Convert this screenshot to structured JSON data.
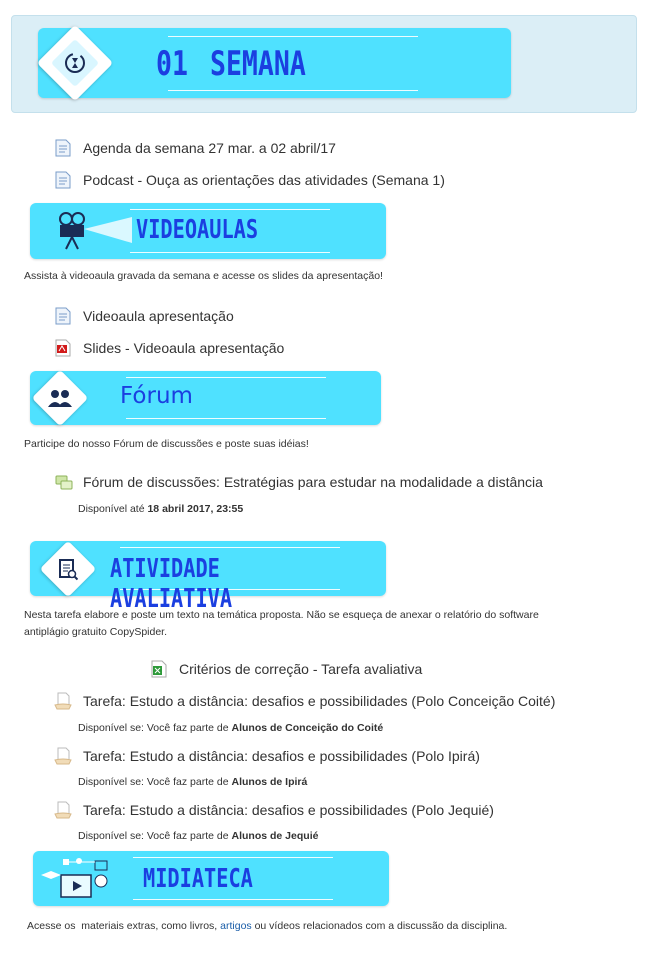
{
  "week_header": {
    "number": "01",
    "label": "SEMANA"
  },
  "resources_top": [
    {
      "label": "Agenda da semana 27 mar. a 02 abril/17",
      "icon": "page-icon"
    },
    {
      "label": "Podcast - Ouça as orientações das atividades (Semana 1)",
      "icon": "page-icon"
    }
  ],
  "videoaulas": {
    "title": "VIDEOAULAS",
    "description": "Assista à videoaula gravada da semana e acesse os slides da apresentação!",
    "items": [
      {
        "label": "Videoaula apresentação",
        "icon": "page-icon"
      },
      {
        "label": "Slides - Videoaula apresentação",
        "icon": "pdf-icon"
      }
    ]
  },
  "forum": {
    "title": "Fórum",
    "description": "Participe do nosso Fórum de discussões e poste suas idéias!",
    "item": {
      "label": "Fórum de discussões: Estratégias para estudar na modalidade a distância",
      "avail_prefix": "Disponível até ",
      "avail_value": "18 abril 2017, 23:55"
    }
  },
  "atividade": {
    "title": "ATIVIDADE AVALIATIVA",
    "description_line1": "Nesta tarefa elabore e poste um texto na temática proposta. Não se esqueça de anexar o relatório do software",
    "description_line2": "antiplágio gratuito CopySpider.",
    "criteria": {
      "label": "Critérios de correção - Tarefa avaliativa",
      "icon": "spreadsheet-icon"
    },
    "tasks": [
      {
        "label": "Tarefa: Estudo a distância: desafios e possibilidades (Polo Conceição Coité)",
        "avail_prefix": "Disponível se: Você faz parte de ",
        "avail_value": "Alunos de Conceição do Coité"
      },
      {
        "label": "Tarefa: Estudo a distância: desafios e possibilidades (Polo Ipirá)",
        "avail_prefix": "Disponível se: Você faz parte de ",
        "avail_value": "Alunos de Ipirá"
      },
      {
        "label": "Tarefa: Estudo a distância: desafios e possibilidades (Polo Jequié)",
        "avail_prefix": "Disponível se: Você faz parte de ",
        "avail_value": "Alunos de Jequié"
      }
    ]
  },
  "midiateca": {
    "title": "MIDIATECA",
    "description_before": "Acesse os  materiais extras, como livros, ",
    "description_link": "artigos",
    "description_after": " ou vídeos relacionados com a discussão da disciplina."
  },
  "colors": {
    "banner": "#4fe1ff",
    "title": "#1b3fe0",
    "panel": "#dbeef6"
  }
}
